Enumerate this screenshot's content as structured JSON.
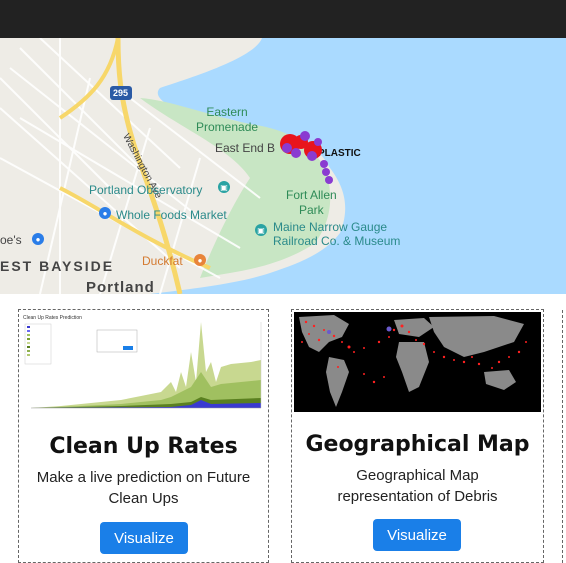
{
  "map": {
    "labels": {
      "eastern_promenade": "Eastern\nPromenade",
      "east_end_beach": "East End B",
      "plastic": "PLASTIC",
      "washington_ave": "Washington Ave",
      "portland_observatory": "Portland Observatory",
      "whole_foods": "Whole Foods Market",
      "fort_allen_park": "Fort Allen\nPark",
      "maine_narrow_gauge": "Maine Narrow Gauge\nRailroad Co. & Museum",
      "joes": "oe's",
      "east_bayside": "EST BAYSIDE",
      "duckfat": "Duckfat",
      "portland": "Portland",
      "route": "295"
    }
  },
  "cards": [
    {
      "title": "Clean Up Rates",
      "description": "Make a live prediction on Future Clean Ups",
      "button": "Visualize",
      "thumb_title": "Clean Up Rates Prediction"
    },
    {
      "title": "Geographical Map",
      "description": "Geographical Map representation of Debris",
      "button": "Visualize"
    }
  ],
  "colors": {
    "button": "#1a7fe8",
    "topbar": "#222222",
    "water": "#aadaff",
    "marker_red": "#e8141c",
    "marker_purple": "#8a3bd1"
  }
}
